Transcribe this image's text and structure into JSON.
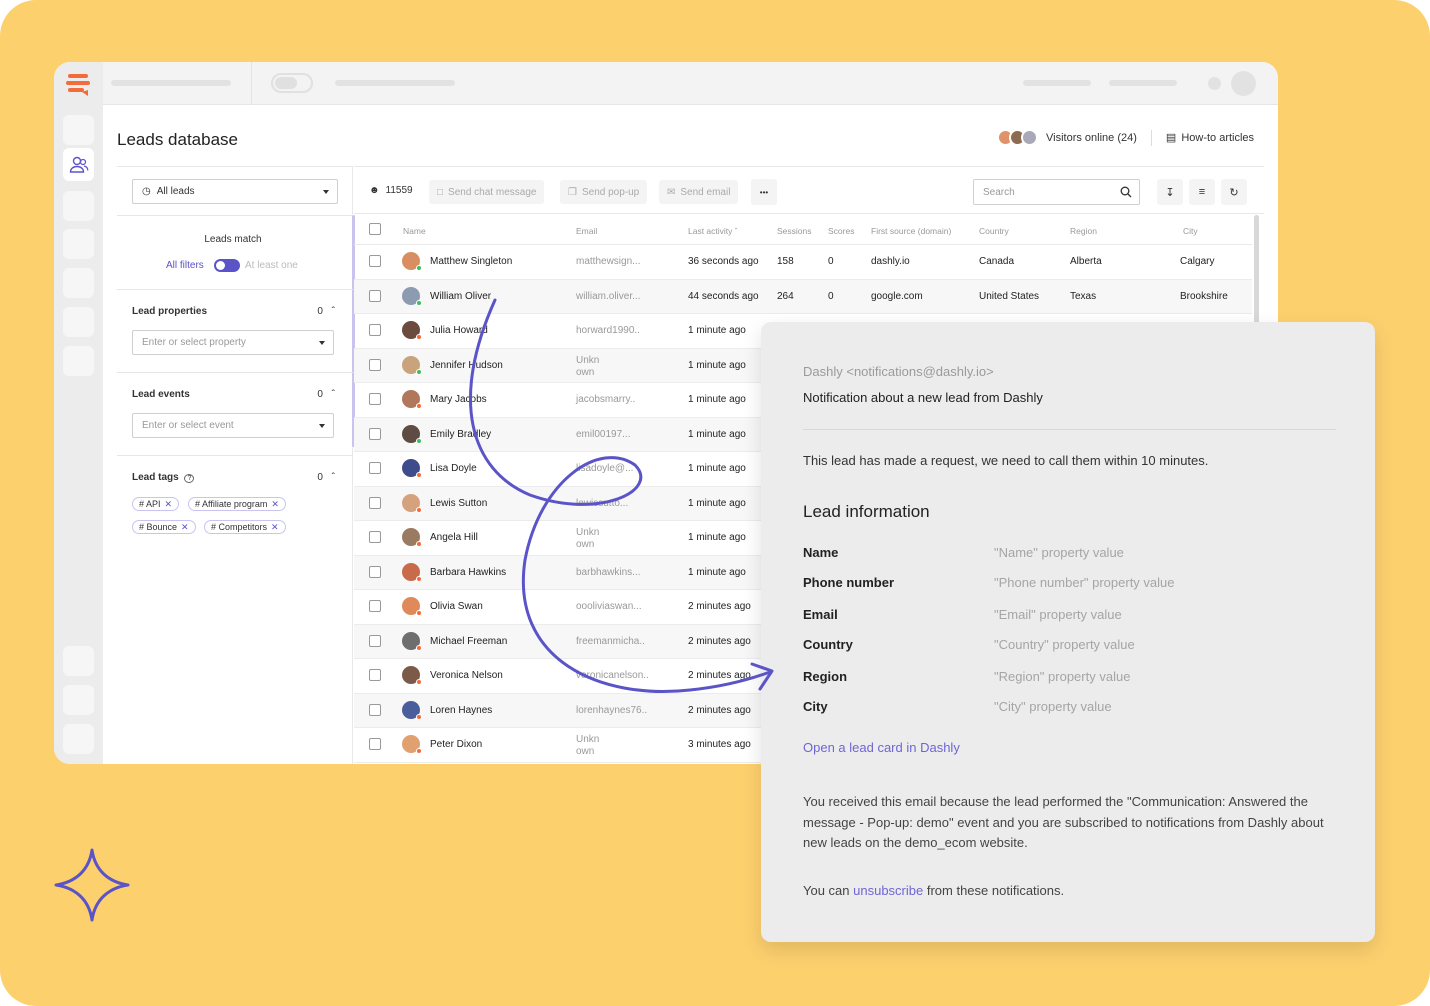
{
  "page": {
    "title": "Leads database"
  },
  "header": {
    "visitors_online": "Visitors online (24)",
    "how_to": "How-to articles"
  },
  "filters": {
    "segment": "All leads",
    "leads_match": "Leads match",
    "all_filters": "All filters",
    "at_least_one": "At least one",
    "lead_properties": {
      "title": "Lead properties",
      "count": "0",
      "placeholder": "Enter or select property"
    },
    "lead_events": {
      "title": "Lead events",
      "count": "0",
      "placeholder": "Enter or select event"
    },
    "lead_tags": {
      "title": "Lead tags",
      "count": "0",
      "tags": [
        "# API",
        "# Affiliate program",
        "# Bounce",
        "# Competitors"
      ]
    }
  },
  "toolbar": {
    "lead_count": "11559",
    "send_chat": "Send chat message",
    "send_popup": "Send pop-up",
    "send_email": "Send email",
    "more": "•••",
    "search_placeholder": "Search"
  },
  "table": {
    "columns": {
      "name": "Name",
      "email": "Email",
      "last_activity": "Last activity",
      "sessions": "Sessions",
      "scores": "Scores",
      "first_source": "First source (domain)",
      "country": "Country",
      "region": "Region",
      "city": "City"
    },
    "rows": [
      {
        "name": "Matthew Singleton",
        "email": "matthewsign...",
        "last_activity": "36 seconds ago",
        "sessions": "158",
        "scores": "0",
        "source": "dashly.io",
        "country": "Canada",
        "region": "Alberta",
        "city": "Calgary"
      },
      {
        "name": "William Oliver",
        "email": "william.oliver...",
        "last_activity": "44 seconds ago",
        "sessions": "264",
        "scores": "0",
        "source": "google.com",
        "country": "United States",
        "region": "Texas",
        "city": "Brookshire"
      },
      {
        "name": "Julia Howard",
        "email": "horward1990..",
        "last_activity": "1 minute ago"
      },
      {
        "name": "Jennifer Hudson",
        "email": "Unkn own",
        "last_activity": "1 minute ago"
      },
      {
        "name": "Mary Jacobs",
        "email": "jacobsmarry..",
        "last_activity": "1 minute ago"
      },
      {
        "name": "Emily Bradley",
        "email": "emil00197...",
        "last_activity": "1 minute ago"
      },
      {
        "name": "Lisa Doyle",
        "email": "lisadoyle@...",
        "last_activity": "1 minute ago"
      },
      {
        "name": "Lewis Sutton",
        "email": "lewissutto...",
        "last_activity": "1 minute ago"
      },
      {
        "name": "Angela Hill",
        "email": "Unkn own",
        "last_activity": "1 minute ago"
      },
      {
        "name": "Barbara Hawkins",
        "email": "barbhawkins...",
        "last_activity": "1 minute ago"
      },
      {
        "name": "Olivia Swan",
        "email": "oooliviaswan...",
        "last_activity": "2 minutes ago"
      },
      {
        "name": "Michael Freeman",
        "email": "freemanmicha..",
        "last_activity": "2 minutes ago"
      },
      {
        "name": "Veronica Nelson",
        "email": "veronicanelson..",
        "last_activity": "2 minutes ago"
      },
      {
        "name": "Loren Haynes",
        "email": "lorenhaynes76..",
        "last_activity": "2 minutes ago"
      },
      {
        "name": "Peter Dixon",
        "email": "Unkn own",
        "last_activity": "3 minutes ago"
      }
    ]
  },
  "email_card": {
    "from": "Dashly <notifications@dashly.io>",
    "subject": "Notification about a new lead from Dashly",
    "request": "This lead has made a request, we need to call them within 10 minutes.",
    "info_title": "Lead information",
    "fields": [
      {
        "label": "Name",
        "value": "\"Name\" property value"
      },
      {
        "label": "Phone number",
        "value": "\"Phone number\" property value"
      },
      {
        "label": "Email",
        "value": "\"Email\" property value"
      },
      {
        "label": "Country",
        "value": "\"Country\" property value"
      },
      {
        "label": "Region",
        "value": "\"Region\" property value"
      },
      {
        "label": "City",
        "value": "\"City\" property value"
      }
    ],
    "open_link": "Open a lead card in Dashly",
    "note": "You received this email because the lead performed the \"Communication: Answered the message - Pop-up: demo\" event and you are subscribed to notifications from Dashly about new leads on the demo_ecom website.",
    "unsub_prefix": "You can ",
    "unsub_link": "unsubscribe",
    "unsub_suffix": " from these notifications."
  },
  "colors": {
    "background": "#FDD06E",
    "accent": "#5B53C8",
    "brand": "#F26B3A"
  }
}
